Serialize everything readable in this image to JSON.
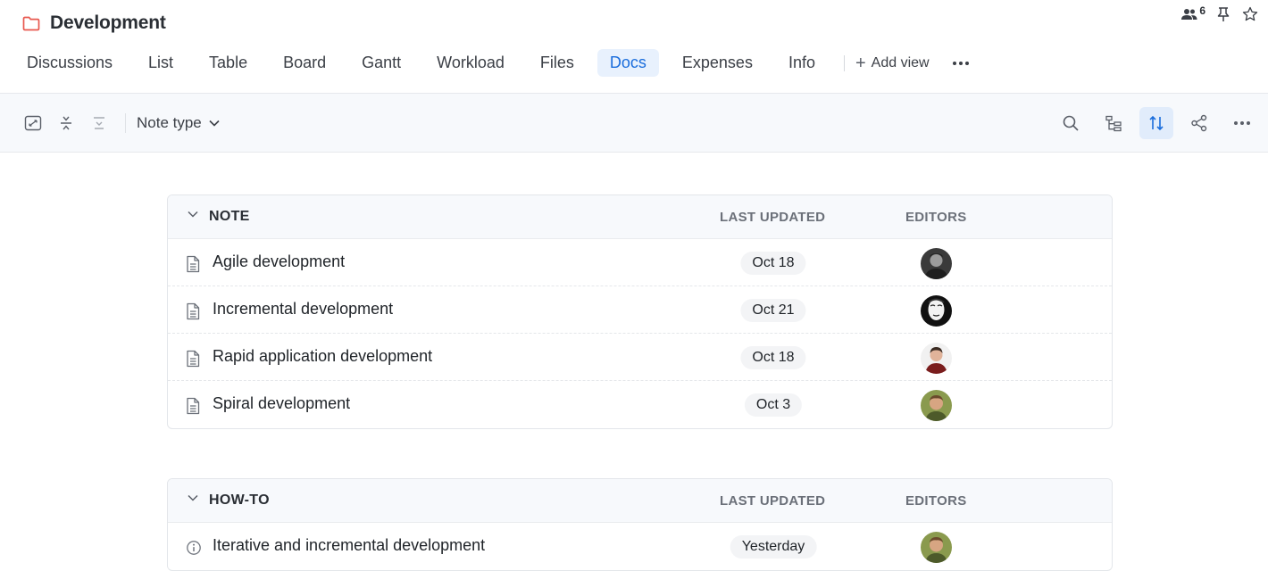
{
  "header": {
    "title": "Development",
    "member_count": "6",
    "colors": {
      "folder": "#e8584f",
      "accent": "#1a6ddc"
    }
  },
  "tabs": [
    {
      "label": "Discussions",
      "active": false
    },
    {
      "label": "List",
      "active": false
    },
    {
      "label": "Table",
      "active": false
    },
    {
      "label": "Board",
      "active": false
    },
    {
      "label": "Gantt",
      "active": false
    },
    {
      "label": "Workload",
      "active": false
    },
    {
      "label": "Files",
      "active": false
    },
    {
      "label": "Docs",
      "active": true
    },
    {
      "label": "Expenses",
      "active": false
    },
    {
      "label": "Info",
      "active": false
    }
  ],
  "add_view_label": "Add view",
  "toolbar": {
    "filter_label": "Note type",
    "icons": [
      "expand-icon",
      "collapse-icon",
      "collapse-all-icon",
      "search-icon",
      "tree-view-icon",
      "sort-icon",
      "share-icon",
      "more-icon"
    ]
  },
  "groups": [
    {
      "title": "NOTE",
      "col_updated": "LAST UPDATED",
      "col_editors": "EDITORS",
      "rows": [
        {
          "title": "Agile development",
          "updated": "Oct 18",
          "icon": "document-icon",
          "avatar": "dark"
        },
        {
          "title": "Incremental development",
          "updated": "Oct 21",
          "icon": "document-icon",
          "avatar": "sketch"
        },
        {
          "title": "Rapid application development",
          "updated": "Oct 18",
          "icon": "document-icon",
          "avatar": "red"
        },
        {
          "title": "Spiral development",
          "updated": "Oct 3",
          "icon": "document-icon",
          "avatar": "green"
        }
      ]
    },
    {
      "title": "HOW-TO",
      "col_updated": "LAST UPDATED",
      "col_editors": "EDITORS",
      "rows": [
        {
          "title": "Iterative and incremental development",
          "updated": "Yesterday",
          "icon": "info-icon",
          "avatar": "green"
        }
      ]
    }
  ]
}
